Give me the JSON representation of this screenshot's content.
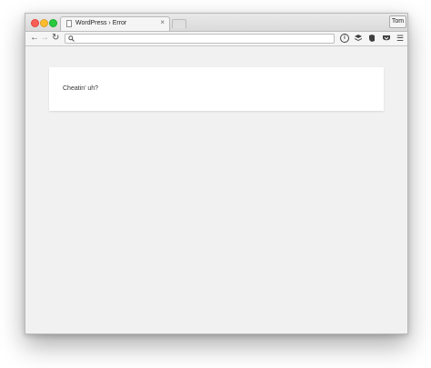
{
  "browser": {
    "tab": {
      "title": "WordPress › Error",
      "close_glyph": "×"
    },
    "profile_name": "Tom",
    "address_bar": {
      "value": "",
      "search_icon": "search-icon"
    },
    "toolbar_icons": [
      "info-icon",
      "layers-icon",
      "evernote-icon",
      "pocket-icon",
      "menu-icon"
    ]
  },
  "page": {
    "message": "Cheatin’ uh?"
  },
  "colors": {
    "close": "#fc5f57",
    "minimize": "#fdbc2e",
    "maximize": "#29c940",
    "page_background": "#f1f1f1",
    "card_background": "#ffffff"
  }
}
